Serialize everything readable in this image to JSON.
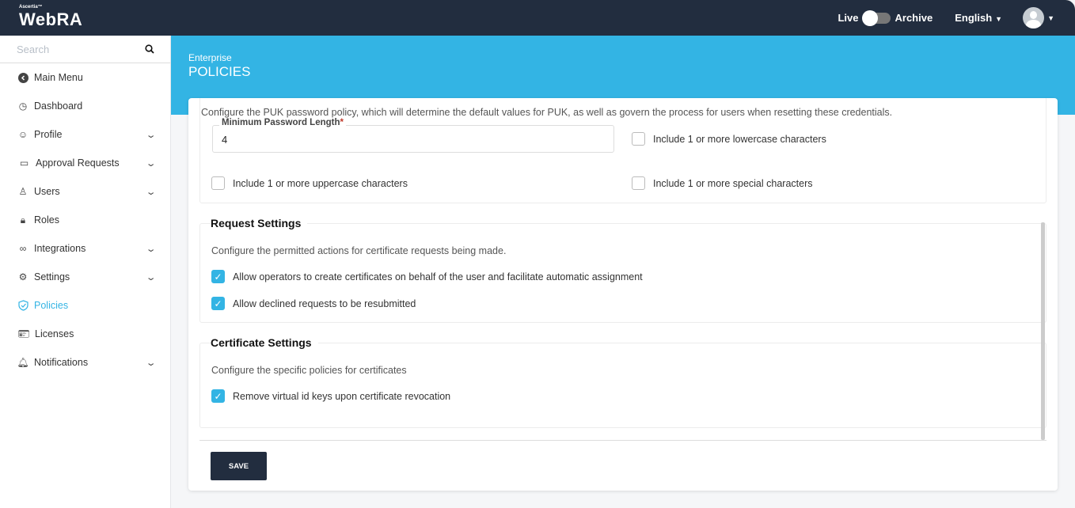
{
  "header": {
    "brand_small": "Ascertia™",
    "brand": "WebRA",
    "live": "Live",
    "archive": "Archive",
    "language": "English"
  },
  "sidebar": {
    "search_placeholder": "Search",
    "items": [
      {
        "label": "Main Menu",
        "icon": "back-circle-icon"
      },
      {
        "label": "Dashboard",
        "icon": "gauge-icon"
      },
      {
        "label": "Profile",
        "icon": "user-circle-icon"
      },
      {
        "label": "Approval Requests",
        "icon": "approval-icon"
      },
      {
        "label": "Users",
        "icon": "users-icon"
      },
      {
        "label": "Roles",
        "icon": "lock-icon"
      },
      {
        "label": "Integrations",
        "icon": "link-icon"
      },
      {
        "label": "Settings",
        "icon": "gear-icon"
      },
      {
        "label": "Policies",
        "icon": "shield-icon"
      },
      {
        "label": "Licenses",
        "icon": "id-card-icon"
      },
      {
        "label": "Notifications",
        "icon": "bell-icon"
      }
    ]
  },
  "banner": {
    "subtitle": "Enterprise",
    "title": "POLICIES"
  },
  "puk": {
    "description": "Configure the PUK password policy, which will determine the default values for PUK, as well as govern the process for users when resetting these credentials.",
    "min_length_label": "Minimum Password Length",
    "required_mark": "*",
    "min_length_value": "4",
    "options": [
      {
        "label": "Include 1 or more lowercase characters",
        "checked": false
      },
      {
        "label": "Include 1 or more uppercase characters",
        "checked": false
      },
      {
        "label": "Include 1 or more special characters",
        "checked": false
      }
    ]
  },
  "request": {
    "title": "Request Settings",
    "description": "Configure the permitted actions for certificate requests being made.",
    "options": [
      {
        "label": "Allow operators to create certificates on behalf of the user and facilitate automatic assignment",
        "checked": true
      },
      {
        "label": "Allow declined requests to be resubmitted",
        "checked": true
      }
    ]
  },
  "certificate": {
    "title": "Certificate Settings",
    "description": "Configure the specific policies for certificates",
    "options": [
      {
        "label": "Remove virtual id keys upon certificate revocation",
        "checked": true
      }
    ]
  },
  "save_label": "SAVE",
  "colors": {
    "accent": "#33b4e4",
    "header": "#222d3f"
  }
}
